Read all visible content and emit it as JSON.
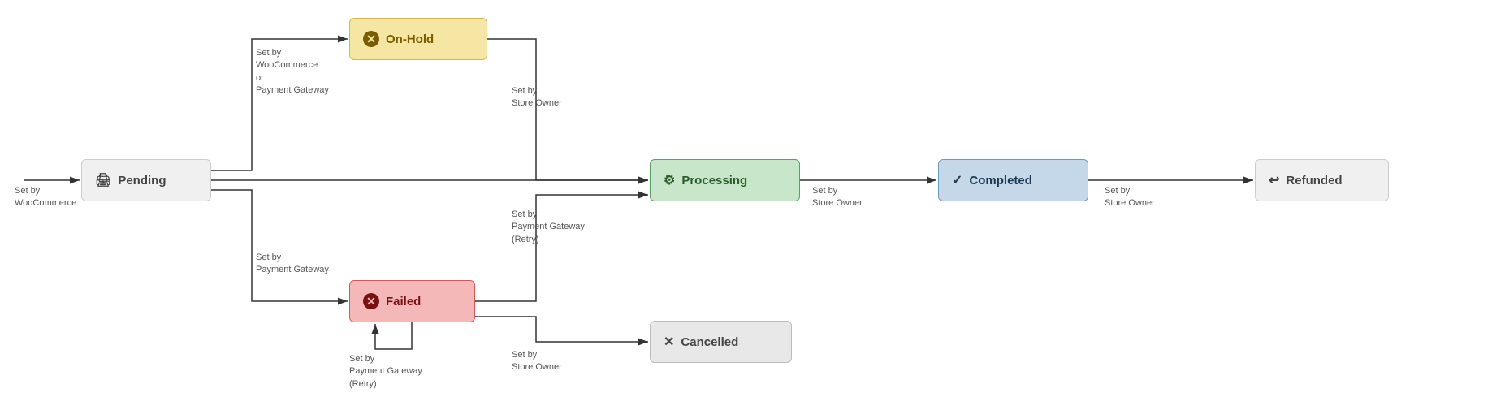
{
  "nodes": {
    "pending": {
      "label": "Pending",
      "icon": "🖨"
    },
    "onhold": {
      "label": "On-Hold",
      "icon": "✕"
    },
    "failed": {
      "label": "Failed",
      "icon": "✕"
    },
    "processing": {
      "label": "Processing",
      "icon": "⚙"
    },
    "completed": {
      "label": "Completed",
      "icon": "✓"
    },
    "refunded": {
      "label": "Refunded",
      "icon": "↩"
    },
    "cancelled": {
      "label": "Cancelled",
      "icon": "✕"
    }
  },
  "labels": {
    "set_by_woocommerce": "Set by\nWooCommerce",
    "set_by_woocommerce_or_gateway": "Set by\nWooCommerce\nor\nPayment Gateway",
    "set_by_store_owner_1": "Set by\nStore Owner",
    "set_by_store_owner_2": "Set by\nStore Owner",
    "set_by_store_owner_3": "Set by\nStore Owner",
    "set_by_store_owner_4": "Set by\nStore Owner",
    "set_by_payment_gateway": "Set by\nPayment Gateway",
    "set_by_payment_gateway_retry_1": "Set by\nPayment Gateway\n(Retry)",
    "set_by_payment_gateway_retry_2": "Set by\nPayment Gateway\n(Retry)"
  }
}
